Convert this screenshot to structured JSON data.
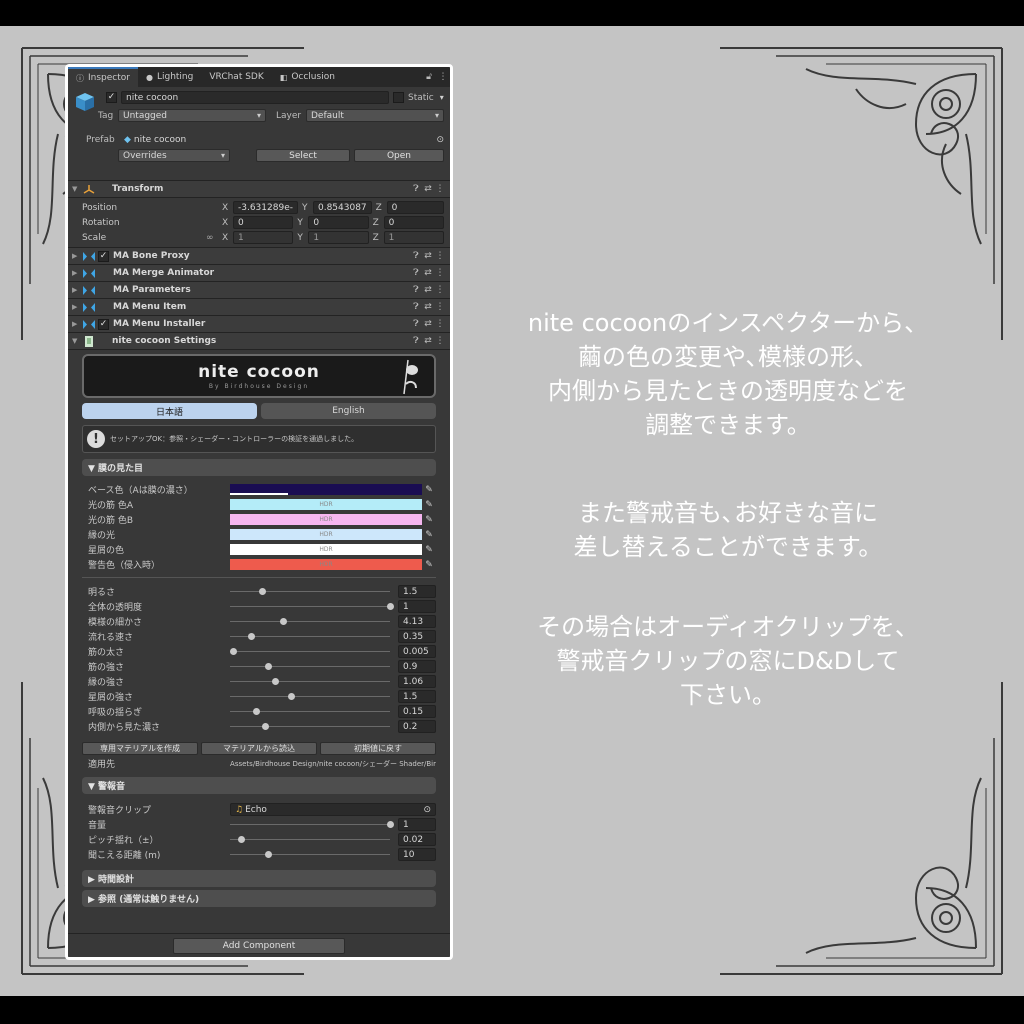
{
  "tabs": [
    {
      "label": "Inspector",
      "icon": "info-icon"
    },
    {
      "label": "Lighting",
      "icon": "bulb-icon"
    },
    {
      "label": "VRChat SDK",
      "icon": ""
    },
    {
      "label": "Occlusion",
      "icon": "occlusion-icon"
    }
  ],
  "object": {
    "name": "nite cocoon",
    "static_label": "Static",
    "tag_label": "Tag",
    "tag_value": "Untagged",
    "layer_label": "Layer",
    "layer_value": "Default",
    "prefab_label": "Prefab",
    "prefab_value": "nite cocoon",
    "overrides_label": "Overrides",
    "select_label": "Select",
    "open_label": "Open"
  },
  "transform": {
    "title": "Transform",
    "rows": [
      {
        "name": "Position",
        "x": "-3.631289e-",
        "y": "0.8543087",
        "z": "0"
      },
      {
        "name": "Rotation",
        "x": "0",
        "y": "0",
        "z": "0"
      },
      {
        "name": "Scale",
        "x": "1",
        "y": "1",
        "z": "1"
      }
    ]
  },
  "components": [
    {
      "name": "MA Bone Proxy",
      "checked": true
    },
    {
      "name": "MA Merge Animator",
      "checked": false
    },
    {
      "name": "MA Parameters",
      "checked": false
    },
    {
      "name": "MA Menu Item",
      "checked": false
    },
    {
      "name": "MA Menu Installer",
      "checked": true
    }
  ],
  "settings": {
    "title": "nite cocoon Settings",
    "logo_title": "nite cocoon",
    "logo_sub": "By Birdhouse Design",
    "lang_ja": "日本語",
    "lang_en": "English",
    "help": "セットアップOK：参照・シェーダー・コントローラーの検証を通過しました。",
    "section_look": "▼ 膜の見た目",
    "hdr": "HDR",
    "colors": [
      {
        "name": "ベース色（Aは膜の濃さ）",
        "color": "#1a0d52",
        "hdr": false
      },
      {
        "name": "光の筋 色A",
        "color": "#b4ecf8",
        "hdr": true
      },
      {
        "name": "光の筋 色B",
        "color": "#f6b6f0",
        "hdr": true
      },
      {
        "name": "縁の光",
        "color": "#cde7fb",
        "hdr": true
      },
      {
        "name": "星屑の色",
        "color": "#ffffff",
        "hdr": true
      },
      {
        "name": "警告色（侵入時）",
        "color": "#ee5b4d",
        "hdr": true
      }
    ],
    "sliders": [
      {
        "name": "明るさ",
        "value": "1.5",
        "pos": 0.2
      },
      {
        "name": "全体の透明度",
        "value": "1",
        "pos": 1.0
      },
      {
        "name": "模様の細かさ",
        "value": "4.13",
        "pos": 0.33
      },
      {
        "name": "流れる速さ",
        "value": "0.35",
        "pos": 0.13
      },
      {
        "name": "筋の太さ",
        "value": "0.005",
        "pos": 0.02
      },
      {
        "name": "筋の強さ",
        "value": "0.9",
        "pos": 0.24
      },
      {
        "name": "縁の強さ",
        "value": "1.06",
        "pos": 0.28
      },
      {
        "name": "星屑の強さ",
        "value": "1.5",
        "pos": 0.38
      },
      {
        "name": "呼吸の揺らぎ",
        "value": "0.15",
        "pos": 0.16
      },
      {
        "name": "内側から見た濃さ",
        "value": "0.2",
        "pos": 0.22
      }
    ],
    "btn_create": "専用マテリアルを作成",
    "btn_load": "マテリアルから読込",
    "btn_reset": "初期値に戻す",
    "apply_label": "適用先",
    "apply_value": "Assets/Birdhouse Design/nite cocoon/シェーダー Shader/Bir",
    "section_alarm": "▼ 警報音",
    "clip_label": "警報音クリップ",
    "clip_value": "Echo",
    "alarm_sliders": [
      {
        "name": "音量",
        "value": "1",
        "pos": 1.0
      },
      {
        "name": "ピッチ揺れ（±）",
        "value": "0.02",
        "pos": 0.07
      },
      {
        "name": "聞こえる距離 (m)",
        "value": "10",
        "pos": 0.24
      }
    ],
    "section_timing": "▶ 時間設計",
    "section_ref": "▶ 参照 (通常は触りません)",
    "add_component": "Add Component"
  },
  "caption": {
    "p1": [
      "nite cocoonのインスペクターから、",
      "繭の色の変更や､模様の形、",
      "内側から見たときの透明度などを",
      "調整できます。"
    ],
    "p2": [
      "また警戒音も､お好きな音に",
      "差し替えることができます。"
    ],
    "p3": [
      "その場合はオーディオクリップを、",
      "警戒音クリップの窓にD&Dして",
      "下さい。"
    ]
  }
}
